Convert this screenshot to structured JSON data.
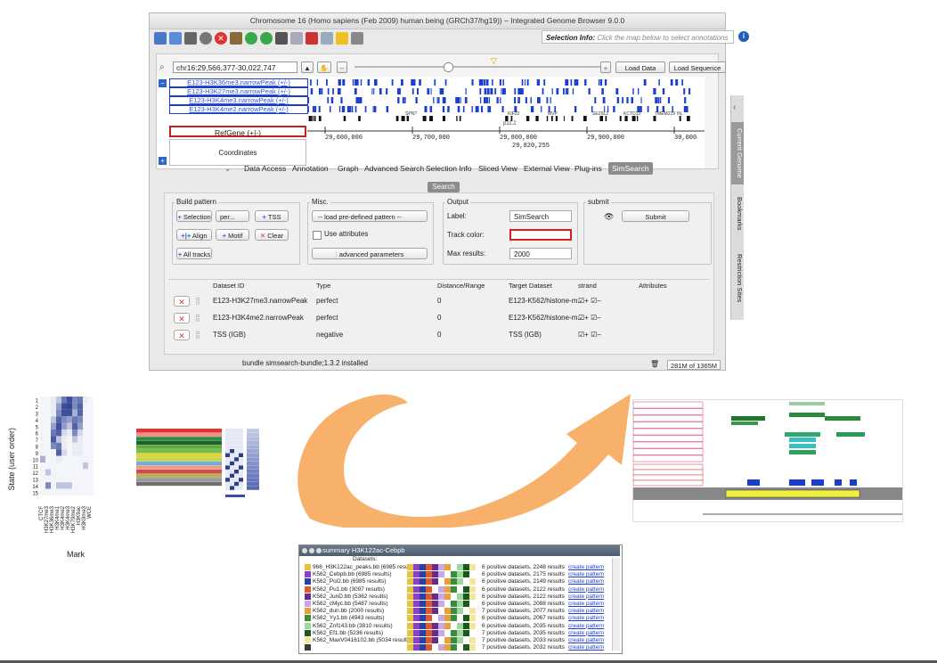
{
  "window": {
    "title": "Chromosome 16  (Homo sapiens (Feb 2009) human being (GRCh37/hg19)) – Integrated Genome Browser 9.0.0",
    "selection_info_label": "Selection Info:",
    "selection_info_placeholder": "Click the map below to select annotations"
  },
  "map": {
    "coordinates": "chr16:29,566,377-30,022,747",
    "load_data": "Load Data",
    "load_sequence": "Load Sequence",
    "tracks": [
      "E123-H3K36me3.narrowPeak (+/-)",
      "E123-H3K27me3.narrowPeak (+/-)",
      "E123-H3K4me3.narrowPeak (+/-)",
      "E123-H3K4me2.narrowPeak (+/-)"
    ],
    "refgene_label": "RefGene (+|-)",
    "coordinates_label": "Coordinates",
    "genes": [
      "SPN?",
      "KIF22",
      "MVP",
      "SEZ6L2",
      "KCTD13",
      "TMEM219",
      "IN.."
    ],
    "ticks": [
      "29,600,000",
      "29,700,000",
      "29,800,000",
      "29,900,000",
      "30,000"
    ],
    "band": "p11.2",
    "cursor_position": "29,820,255"
  },
  "tabs": [
    "Data Access",
    "Annotation",
    "Graph",
    "Advanced Search",
    "Selection Info",
    "Sliced View",
    "External View",
    "Plug-ins",
    "SimSearch"
  ],
  "active_tab": "SimSearch",
  "simsearch": {
    "search_button": "Search",
    "build_pattern": {
      "title": "Build pattern",
      "selection": "Selection",
      "per_select": "per...",
      "tss": "TSS",
      "align": "Align",
      "motif": "Motif",
      "clear": "Clear",
      "all_tracks": "All tracks"
    },
    "misc": {
      "title": "Misc.",
      "pattern_select": "-- load pre-defined pattern --",
      "use_attributes": "Use attributes",
      "advanced": "advanced parameters"
    },
    "output": {
      "title": "Output",
      "label_label": "Label:",
      "label_value": "SimSearch",
      "track_color_label": "Track color:",
      "max_results_label": "Max results:",
      "max_results_value": "2000"
    },
    "submit": {
      "title": "submit",
      "button": "Submit"
    },
    "table": {
      "headers": [
        "Dataset ID",
        "Type",
        "Distance/Range",
        "Target Dataset",
        "strand",
        "Attributes"
      ],
      "rows": [
        {
          "dataset": "E123-H3K27me3.narrowPeak",
          "type": "perfect",
          "distance": "0",
          "target": "E123-K562/histone-m...",
          "strand": "☑+ ☑–"
        },
        {
          "dataset": "E123-H3K4me2.narrowPeak",
          "type": "perfect",
          "distance": "0",
          "target": "E123-K562/histone-m...",
          "strand": "☑+ ☑–"
        },
        {
          "dataset": "TSS (IGB)",
          "type": "negative",
          "distance": "0",
          "target": "TSS (IGB)",
          "strand": "☑+ ☑–"
        }
      ]
    }
  },
  "status": {
    "message": "bundle simsearch-bundle;1.3.2 installed",
    "memory": "281M of 1365M"
  },
  "side_tabs": [
    "Current Genome",
    "Bookmarks",
    "Restriction Sites"
  ],
  "heatmap": {
    "ylabel": "State (user order)",
    "xlabel": "Mark",
    "states": [
      "1",
      "2",
      "3",
      "4",
      "5",
      "6",
      "7",
      "8",
      "9",
      "10",
      "11",
      "12",
      "13",
      "14",
      "15"
    ],
    "marks": [
      "CTCF",
      "H3K27me3",
      "H3K36me3",
      "H3K4me1",
      "H3K4me2",
      "H3K4me3",
      "H3K79me2",
      "H3K9ac",
      "H3K9me3",
      "WCE"
    ],
    "values": [
      [
        0.05,
        0.05,
        0.1,
        0.3,
        0.7,
        0.9,
        0.6,
        0.7,
        0.1,
        0.05
      ],
      [
        0.05,
        0.05,
        0.1,
        0.5,
        0.9,
        0.95,
        0.6,
        0.8,
        0.05,
        0.05
      ],
      [
        0.05,
        0.05,
        0.1,
        0.6,
        0.9,
        0.9,
        0.4,
        0.8,
        0.05,
        0.05
      ],
      [
        0.05,
        0.05,
        0.3,
        0.8,
        0.6,
        0.5,
        0.7,
        0.6,
        0.05,
        0.05
      ],
      [
        0.05,
        0.05,
        0.5,
        0.9,
        0.5,
        0.3,
        0.8,
        0.5,
        0.05,
        0.05
      ],
      [
        0.05,
        0.05,
        0.7,
        0.8,
        0.2,
        0.1,
        0.6,
        0.2,
        0.05,
        0.05
      ],
      [
        0.05,
        0.05,
        0.85,
        0.3,
        0.1,
        0.05,
        0.3,
        0.1,
        0.05,
        0.05
      ],
      [
        0.05,
        0.05,
        0.6,
        0.7,
        0.1,
        0.05,
        0.1,
        0.1,
        0.05,
        0.05
      ],
      [
        0.05,
        0.05,
        0.05,
        0.8,
        0.2,
        0.05,
        0.1,
        0.1,
        0.05,
        0.05
      ],
      [
        0.4,
        0.05,
        0.05,
        0.1,
        0.05,
        0.05,
        0.05,
        0.05,
        0.05,
        0.05
      ],
      [
        0.05,
        0.05,
        0.05,
        0.05,
        0.05,
        0.05,
        0.05,
        0.05,
        0.3,
        0.05
      ],
      [
        0.05,
        0.3,
        0.05,
        0.05,
        0.05,
        0.05,
        0.05,
        0.05,
        0.05,
        0.05
      ],
      [
        0.05,
        0.05,
        0.05,
        0.05,
        0.05,
        0.05,
        0.05,
        0.05,
        0.05,
        0.05
      ],
      [
        0.05,
        0.6,
        0.05,
        0.3,
        0.3,
        0.3,
        0.05,
        0.05,
        0.05,
        0.05
      ],
      [
        0.05,
        0.05,
        0.05,
        0.05,
        0.05,
        0.05,
        0.05,
        0.05,
        0.05,
        0.05
      ]
    ]
  },
  "legend_table": {
    "colors": [
      "#e8312d",
      "#f08f8b",
      "#2e8b3e",
      "#18632a",
      "#62a83a",
      "#6fbf4f",
      "#e7d13a",
      "#bfd94a",
      "#7aa9d6",
      "#e9a08b",
      "#d24a4a",
      "#b8ad5d",
      "#9b9b9b",
      "#6f6f6f",
      "#ffffff"
    ]
  },
  "summary": {
    "title": "summary H3K122ac-Cebpb",
    "header": "Datasets:",
    "rows": [
      {
        "name": "966_H3K122ac_peaks.bb (6985 results)",
        "info": "6 positive datasets, 2248 results",
        "link": "create pattern",
        "color": "#e8c23a"
      },
      {
        "name": "K562_Cebpb.bb (6985 results)",
        "info": "6 positive datasets, 2175 results",
        "link": "create pattern",
        "color": "#8c3fc8"
      },
      {
        "name": "K562_Pol2.bb (6985 results)",
        "info": "6 positive datasets, 2149 results",
        "link": "create pattern",
        "color": "#2a3fa8"
      },
      {
        "name": "K562_Pu1.bb (3097 results)",
        "info": "6 positive datasets, 2122 results",
        "link": "create pattern",
        "color": "#e05a2a"
      },
      {
        "name": "K562_JunD.bb (5362 results)",
        "info": "6 positive datasets, 2122 results",
        "link": "create pattern",
        "color": "#6a2a8c"
      },
      {
        "name": "K562_cMyc.bb (5487 results)",
        "info": "6 positive datasets, 2088 results",
        "link": "create pattern",
        "color": "#c8a8e8"
      },
      {
        "name": "K562_dun.bb (2000 results)",
        "info": "7 positive datasets, 2077 results",
        "link": "create pattern",
        "color": "#e8a03a"
      },
      {
        "name": "K562_Yy1.bb (4943 results)",
        "info": "6 positive datasets, 2067 results",
        "link": "create pattern",
        "color": "#3a8c3a"
      },
      {
        "name": "K562_Znf143.bb (3810 results)",
        "info": "6 positive datasets, 2035 results",
        "link": "create pattern",
        "color": "#9cd89c"
      },
      {
        "name": "K562_Ef1.bb (5236 results)",
        "info": "7 positive datasets, 2035 results",
        "link": "create pattern",
        "color": "#1a5a1a"
      },
      {
        "name": "K562_MaxV0416102.bb (5034 results)",
        "info": "7 positive datasets, 2033 results",
        "link": "create pattern",
        "color": "#f2e89a"
      },
      {
        "name": "",
        "info": "7 positive datasets, 2032 results",
        "link": "create pattern",
        "color": "#3a3a3a"
      }
    ]
  }
}
